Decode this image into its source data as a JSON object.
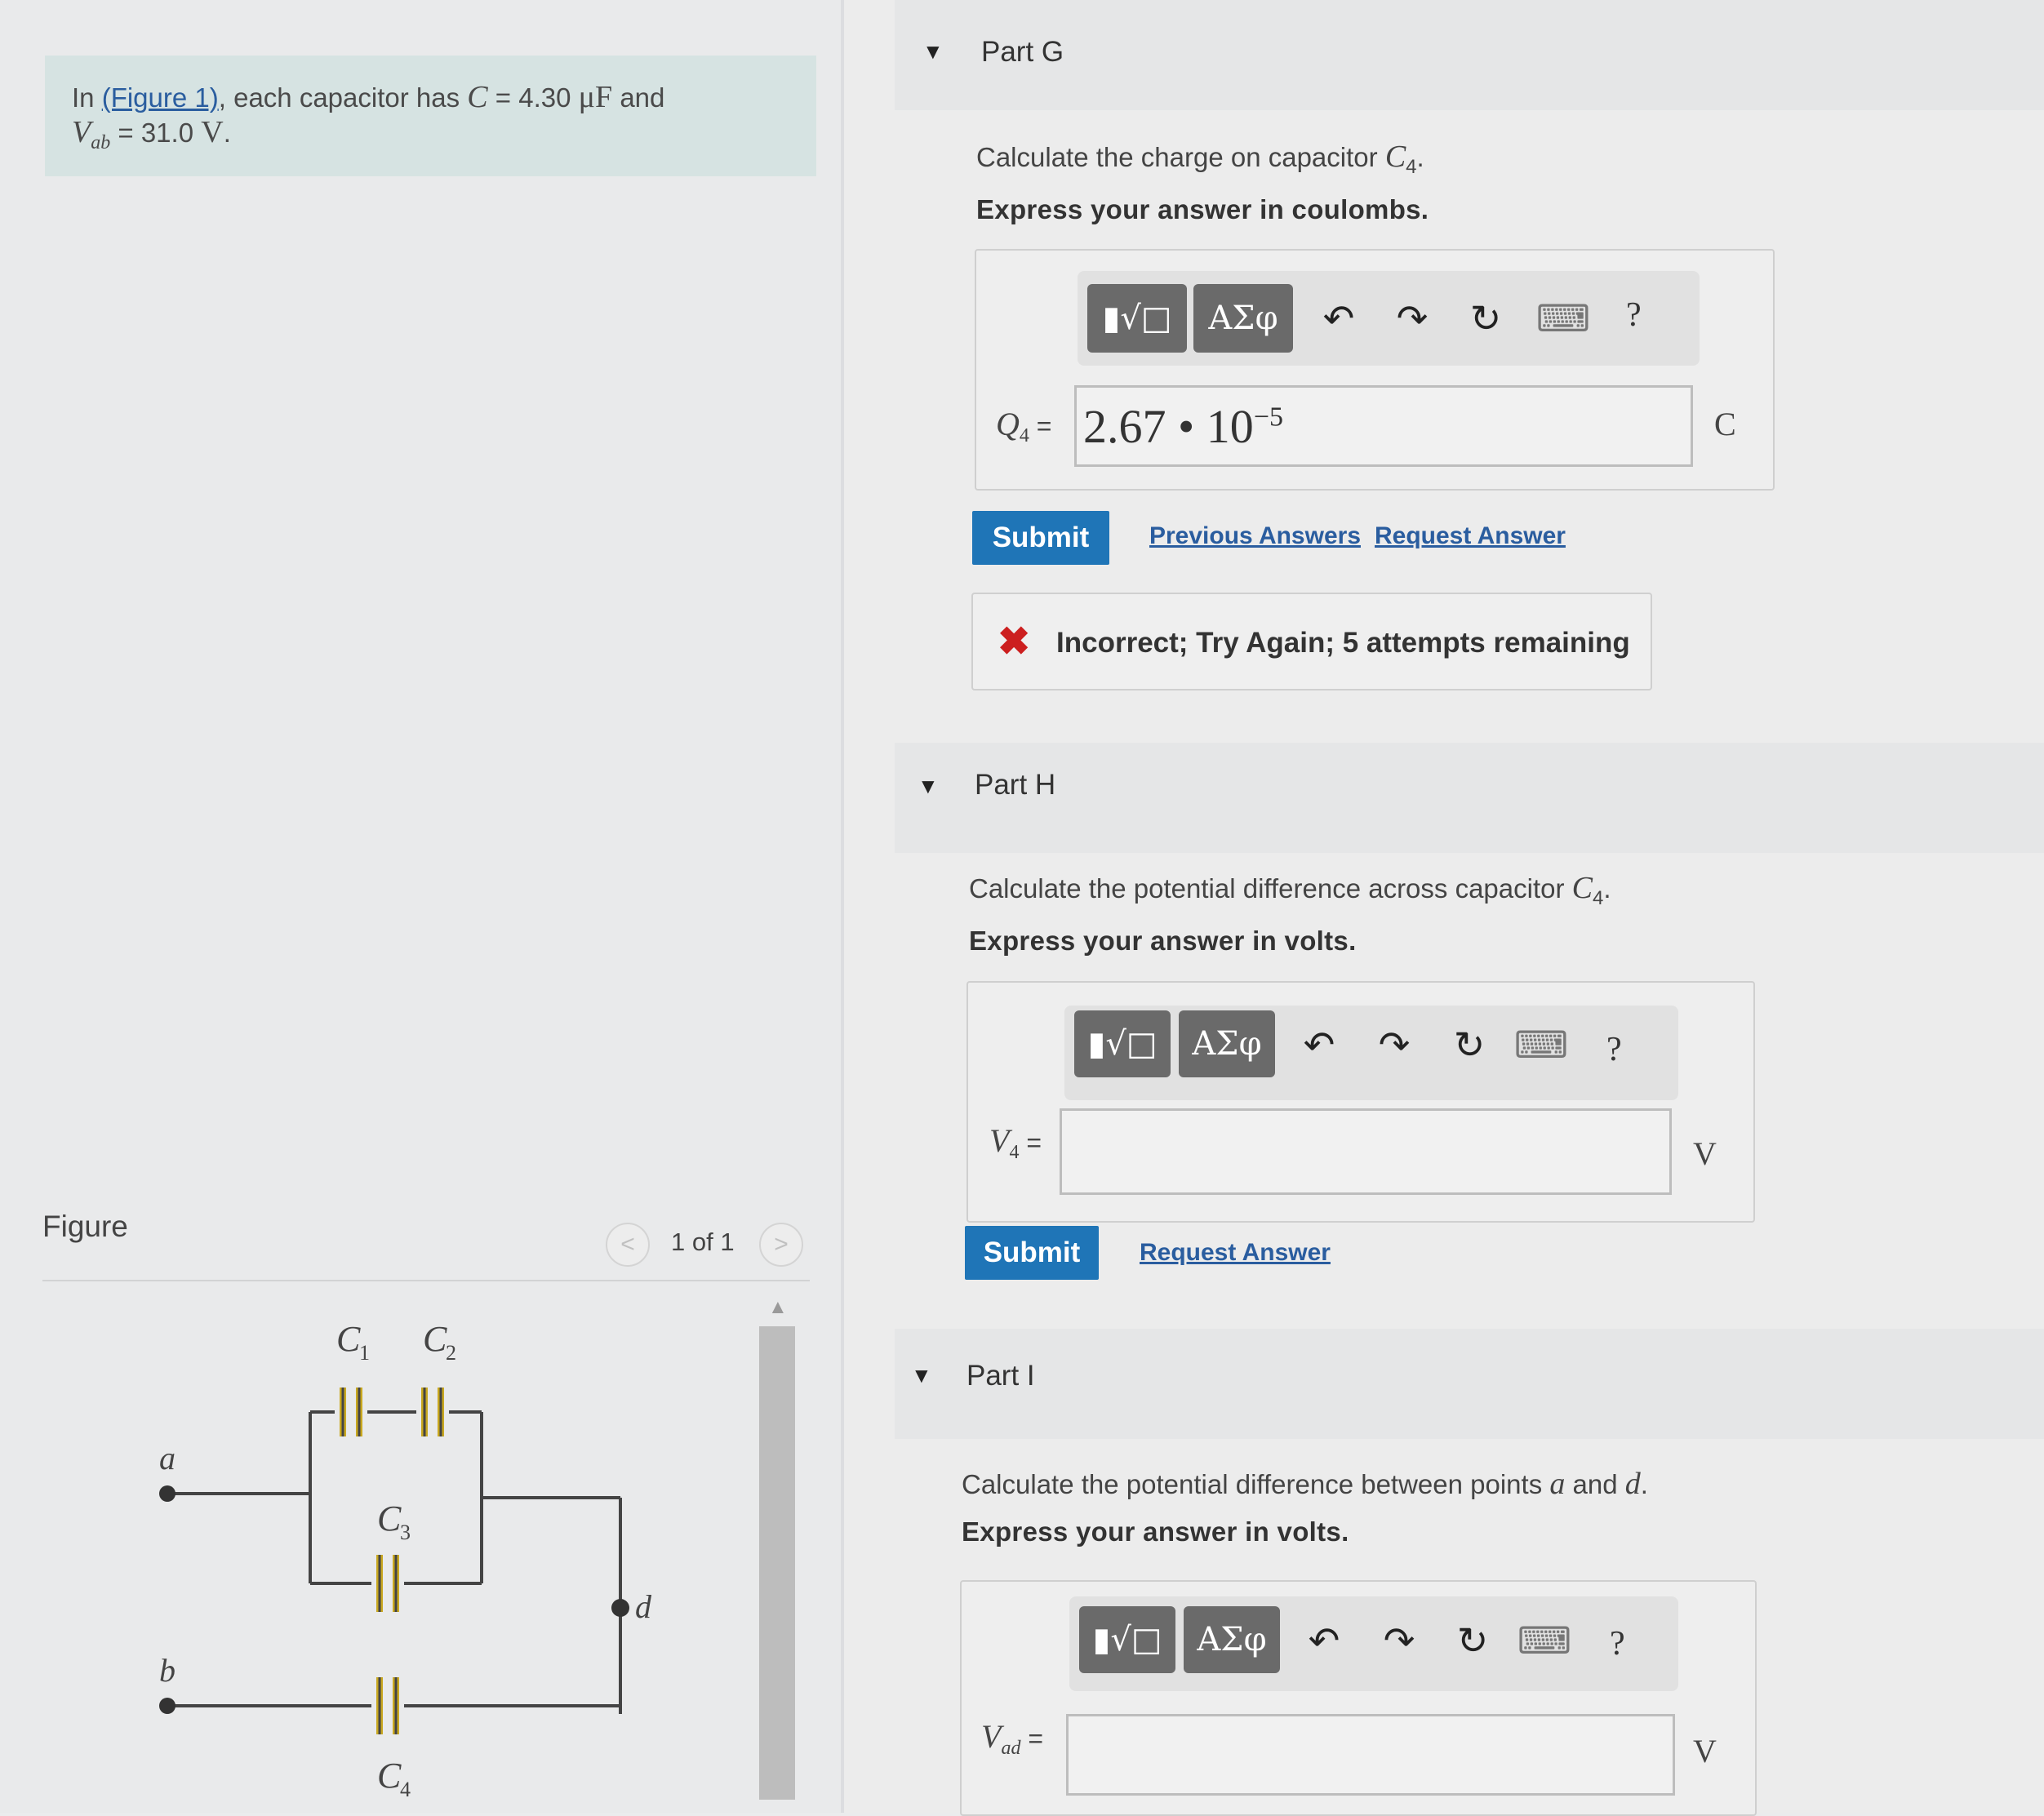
{
  "problem": {
    "prefix": "In ",
    "figure_link": "(Figure 1)",
    "mid": ", each capacitor has ",
    "c_var": "C",
    "c_eq": " = 4.30 ",
    "c_unit": "μF",
    "and": " and",
    "v_var": "V",
    "v_sub": "ab",
    "v_eq": " = 31.0 ",
    "v_unit": "V",
    "end": "."
  },
  "figure": {
    "label": "Figure",
    "pager": "1 of 1",
    "prev_icon": "<",
    "next_icon": ">",
    "scroll_up_icon": "▲",
    "circuit": {
      "c1": "C",
      "c1_sub": "1",
      "c2": "C",
      "c2_sub": "2",
      "c3": "C",
      "c3_sub": "3",
      "c4": "C",
      "c4_sub": "4",
      "node_a": "a",
      "node_b": "b",
      "node_d": "d"
    }
  },
  "toolbar": {
    "templates_icon": "▮√□",
    "greek_icon": "ΑΣφ",
    "undo_icon": "↶",
    "redo_icon": "↷",
    "reset_icon": "↻",
    "keyboard_icon": "⌨",
    "help_icon": "?"
  },
  "partG": {
    "collapse_icon": "▼",
    "title": "Part G",
    "instruction": "Calculate the charge on capacitor ",
    "instruction_var": "C",
    "instruction_sub": "4",
    "instruction_end": ".",
    "express": "Express your answer in coulombs.",
    "var_label": "Q",
    "var_sub": "4",
    "eq": " =",
    "answer_mantissa": "2.67 • 10",
    "answer_exp": "−5",
    "unit": "C",
    "submit": "Submit",
    "prev_answers": "Previous Answers",
    "request_answer": "Request Answer",
    "feedback_icon": "✖",
    "feedback": "Incorrect; Try Again; 5 attempts remaining"
  },
  "partH": {
    "collapse_icon": "▼",
    "title": "Part H",
    "instruction": "Calculate the potential difference across capacitor ",
    "instruction_var": "C",
    "instruction_sub": "4",
    "instruction_end": ".",
    "express": "Express your answer in volts.",
    "var_label": "V",
    "var_sub": "4",
    "eq": " =",
    "answer": "",
    "unit": "V",
    "submit": "Submit",
    "request_answer": "Request Answer"
  },
  "partI": {
    "collapse_icon": "▼",
    "title": "Part I",
    "instruction": "Calculate the potential difference between points ",
    "point_a": "a",
    "and": " and ",
    "point_d": "d",
    "instruction_end": ".",
    "express": "Express your answer in volts.",
    "var_label": "V",
    "var_sub": "ad",
    "eq": " =",
    "answer": "",
    "unit": "V"
  }
}
